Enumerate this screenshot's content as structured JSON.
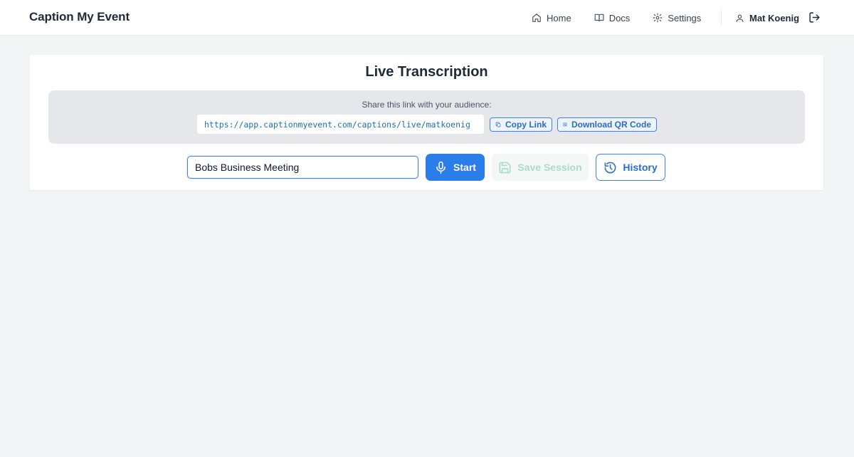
{
  "app": {
    "title": "Caption My Event"
  },
  "nav": {
    "items": [
      {
        "label": "Home",
        "icon": "home-icon"
      },
      {
        "label": "Docs",
        "icon": "book-icon"
      },
      {
        "label": "Settings",
        "icon": "gear-icon"
      }
    ],
    "user": {
      "name": "Mat Koenig",
      "icon": "user-icon"
    },
    "logout_icon": "logout-icon"
  },
  "main": {
    "title": "Live Transcription",
    "share": {
      "label": "Share this link with your audience:",
      "url": "https://app.captionmyevent.com/captions/live/matkoenig",
      "copy_label": "Copy Link",
      "qr_label": "Download QR Code"
    },
    "session": {
      "name_value": "Bobs Business Meeting",
      "start_label": "Start",
      "save_label": "Save Session",
      "save_disabled": true,
      "history_label": "History"
    }
  },
  "colors": {
    "primary": "#2b7de9",
    "primary_text": "#2b6cc4",
    "save_disabled_text": "#a7dccb",
    "page_bg": "#f3f4f6",
    "share_bg": "#e5e7eb"
  }
}
